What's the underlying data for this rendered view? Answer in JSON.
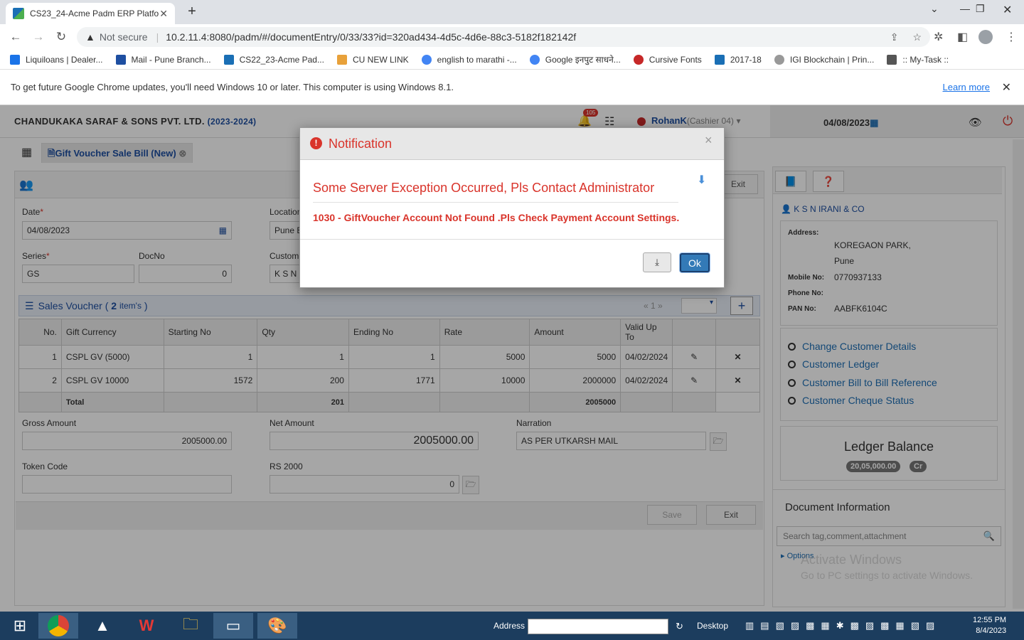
{
  "browser": {
    "tab_title": "CS23_24-Acme Padm ERP Platfor",
    "tab_close": "✕",
    "new_tab": "+",
    "not_secure": "Not secure",
    "url": "10.2.11.4:8080/padm/#/documentEntry/0/33/33?id=320ad434-4d5c-4d6e-88c3-5182f182142f",
    "bookmarks": [
      {
        "label": "Liquiloans | Dealer...",
        "color": "#1a73e8"
      },
      {
        "label": "Mail - Pune Branch...",
        "color": "#1e4fa1"
      },
      {
        "label": "CS22_23-Acme Pad...",
        "color": "#1a6fb5"
      },
      {
        "label": "CU NEW LINK",
        "color": "#e8a13a"
      },
      {
        "label": "english to marathi -...",
        "color": "#4285f4"
      },
      {
        "label": "Google इनपुट साधने...",
        "color": "#4285f4"
      },
      {
        "label": "Cursive Fonts",
        "color": "#c62828"
      },
      {
        "label": "2017-18",
        "color": "#1a6fb5"
      },
      {
        "label": "IGI Blockchain | Prin...",
        "color": "#999999"
      },
      {
        "label": ":: My-Task ::",
        "color": "#555555"
      }
    ],
    "infobar_text": "To get future Google Chrome updates, you'll need Windows 10 or later. This computer is using Windows 8.1.",
    "infobar_link": "Learn more",
    "infobar_close": "✕"
  },
  "app": {
    "company": "CHANDUKAKA SARAF & SONS PVT. LTD.",
    "year": "(2023-2024)",
    "notifications": "105",
    "user": "RohanK",
    "role": "(Cashier 04)",
    "header_date": "04/08/2023",
    "doc_tab": "Gift Voucher Sale Bill (New)",
    "form": {
      "date_label": "Date",
      "date_value": "04/08/2023",
      "location_label": "Location",
      "location_value": "Pune E",
      "series_label": "Series",
      "series_value": "GS",
      "docno_label": "DocNo",
      "docno_value": "0",
      "customer_label": "Custom",
      "customer_value": "K S N I",
      "req": "*",
      "exit_partial": "Exit"
    },
    "sales_voucher": {
      "title": "Sales Voucher (",
      "count": "2",
      "items_label": "item's",
      "close": ")",
      "pager": "« 1 »",
      "columns": [
        "No.",
        "Gift Currency",
        "Starting No",
        "Qty",
        "Ending No",
        "Rate",
        "Amount",
        "Valid Up To",
        "",
        ""
      ],
      "rows": [
        {
          "no": "1",
          "currency": "CSPL GV (5000)",
          "start": "1",
          "qty": "1",
          "end": "1",
          "rate": "5000",
          "amount": "5000",
          "valid": "04/02/2024"
        },
        {
          "no": "2",
          "currency": "CSPL GV 10000",
          "start": "1572",
          "qty": "200",
          "end": "1771",
          "rate": "10000",
          "amount": "2000000",
          "valid": "04/02/2024"
        }
      ],
      "total_label": "Total",
      "total_qty": "201",
      "total_amount": "2005000"
    },
    "totals": {
      "gross_label": "Gross Amount",
      "gross_value": "2005000.00",
      "net_label": "Net Amount",
      "net_value": "2005000.00",
      "narration_label": "Narration",
      "narration_value": "AS PER UTKARSH MAIL",
      "token_label": "Token Code",
      "token_value": "",
      "rs2000_label": "RS 2000",
      "rs2000_value": "0"
    },
    "buttons": {
      "save": "Save",
      "exit": "Exit"
    }
  },
  "right_panel": {
    "customer_name": "K S N IRANI & CO",
    "address_label": "Address:",
    "address_line1": "KOREGAON PARK,",
    "address_line2": "Pune",
    "mobile_label": "Mobile No:",
    "mobile_value": "0770937133",
    "phone_label": "Phone No:",
    "phone_value": "",
    "pan_label": "PAN No:",
    "pan_value": "AABFK6104C",
    "links": [
      "Change Customer Details",
      "Customer Ledger",
      "Customer Bill to Bill Reference",
      "Customer Cheque Status"
    ],
    "ledger_title": "Ledger Balance",
    "ledger_value": "20,05,000.00",
    "ledger_type": "Cr",
    "doc_info_title": "Document Information",
    "doc_search_placeholder": "Search tag,comment,attachment",
    "options": "Options",
    "watermark_title": "Activate Windows",
    "watermark_sub": "Go to PC settings to activate Windows."
  },
  "modal": {
    "title": "Notification",
    "icon": "!",
    "close": "×",
    "message": "Some Server Exception Occurred, Pls Contact Administrator",
    "detail": "1030 - GiftVoucher Account Not Found .Pls Check Payment Account Settings.",
    "ok": "Ok"
  },
  "taskbar": {
    "address_label": "Address",
    "desktop_label": "Desktop",
    "time": "12:55 PM",
    "date": "8/4/2023"
  }
}
